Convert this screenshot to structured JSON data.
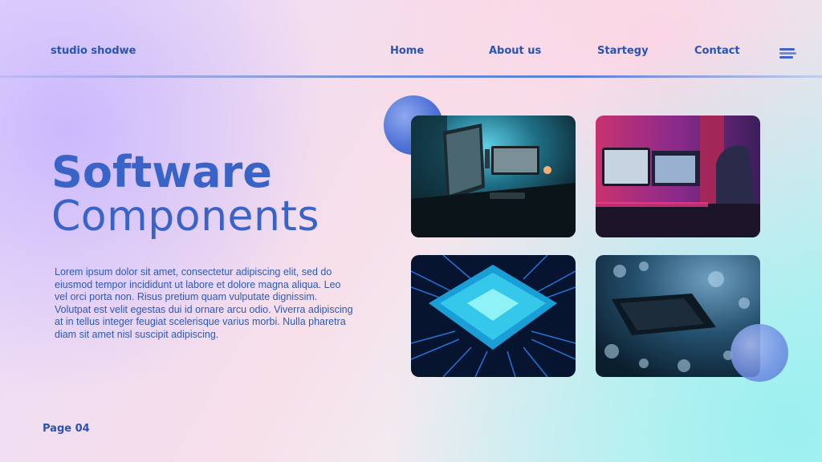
{
  "header": {
    "brand": "studio shodwe",
    "nav": {
      "home": "Home",
      "about": "About us",
      "strategy": "Startegy",
      "contact": "Contact"
    },
    "menu_icon": "hamburger-menu-icon"
  },
  "main": {
    "title_line1": "Software",
    "title_line2": "Components",
    "body": "Lorem ipsum dolor sit amet, consectetur adipiscing elit, sed do eiusmod tempor incididunt ut labore et dolore magna aliqua. Leo vel orci porta non. Risus pretium quam vulputate dignissim. Volutpat est velit egestas dui id ornare arcu odio. Viverra adipiscing at in tellus integer feugiat scelerisque varius morbi. Nulla pharetra diam sit amet nisl suscipit adipiscing."
  },
  "footer": {
    "page_label": "Page 04"
  },
  "colors": {
    "accent": "#3a63c8",
    "text": "#2c5ab6",
    "circle": "#4f72d6"
  },
  "images": [
    {
      "depicts": "monitor-desk-setup-photo"
    },
    {
      "depicts": "gaming-setup-photo"
    },
    {
      "depicts": "cpu-chip-photo"
    },
    {
      "depicts": "circuit-board-photo"
    }
  ]
}
